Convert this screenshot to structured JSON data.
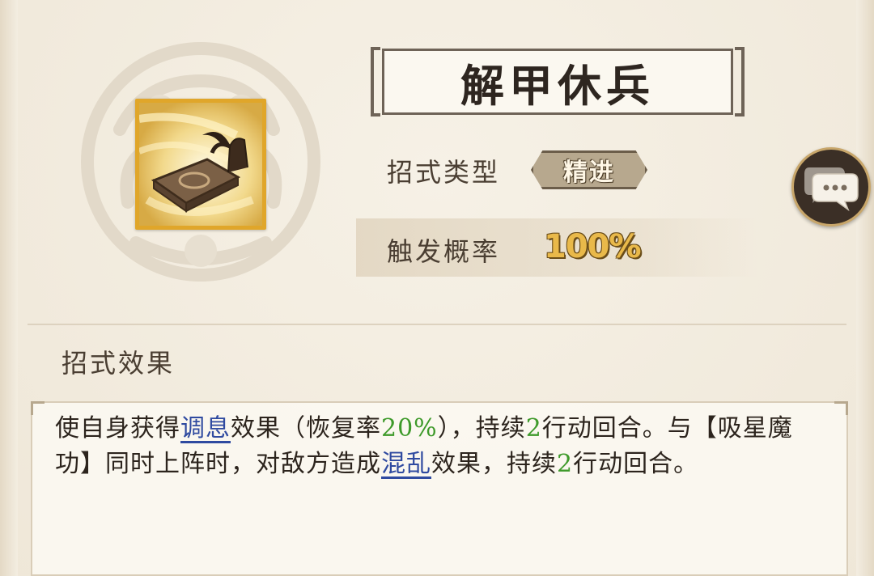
{
  "skill": {
    "name": "解甲休兵",
    "type_label": "招式类型",
    "type_value": "精进",
    "rate_label": "触发概率",
    "rate_value": "100%"
  },
  "effect": {
    "heading": "招式效果",
    "segments": [
      {
        "t": "使自身获得"
      },
      {
        "t": "调息",
        "style": "keyword"
      },
      {
        "t": "效果（恢复率"
      },
      {
        "t": "20%",
        "style": "number"
      },
      {
        "t": "），持续"
      },
      {
        "t": "2",
        "style": "number"
      },
      {
        "t": "行动回合。与【吸星魔功】同时上阵时，对敌方造成"
      },
      {
        "t": "混乱",
        "style": "keyword"
      },
      {
        "t": "效果，持续"
      },
      {
        "t": "2",
        "style": "number"
      },
      {
        "t": "行动回合。"
      }
    ]
  },
  "icons": {
    "skill_icon": "armor-bundle-icon",
    "chat": "chat-bubble-icon"
  },
  "colors": {
    "keyword": "#2f4aa0",
    "number": "#3e9a2a",
    "rate": "#e9b94a",
    "icon_border": "#e0a62a"
  }
}
